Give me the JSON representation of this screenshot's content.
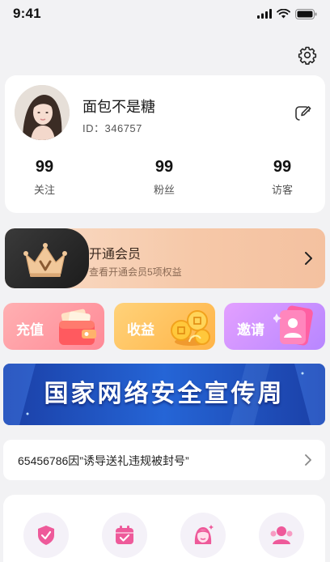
{
  "status_bar": {
    "time": "9:41"
  },
  "profile": {
    "nickname": "面包不是糖",
    "uid": "ID：346757",
    "stats": [
      {
        "value": "99",
        "label": "关注"
      },
      {
        "value": "99",
        "label": "粉丝"
      },
      {
        "value": "99",
        "label": "访客"
      }
    ]
  },
  "vip": {
    "title": "开通会员",
    "subtitle": "查看开通会员5项权益"
  },
  "actions": {
    "recharge": "充值",
    "income": "收益",
    "invite": "邀请"
  },
  "banner": {
    "text": "国家网络安全宣传周"
  },
  "notice": {
    "text": "65456786因”诱导送礼违规被封号”"
  },
  "icons": {
    "settings": "gear-icon",
    "edit": "edit-icon",
    "crown": "crown-icon",
    "row": [
      "shield-check-icon",
      "calendar-check-icon",
      "beauty-face-icon",
      "group-icon"
    ]
  },
  "colors": {
    "background": "#f2f2f4",
    "vip_gradient": "#f6c8a8",
    "recharge": "#ff8a97",
    "income": "#ffb447",
    "invite": "#b786ff",
    "banner": "#2565d6",
    "icon_accent": "#ee5a9a"
  }
}
